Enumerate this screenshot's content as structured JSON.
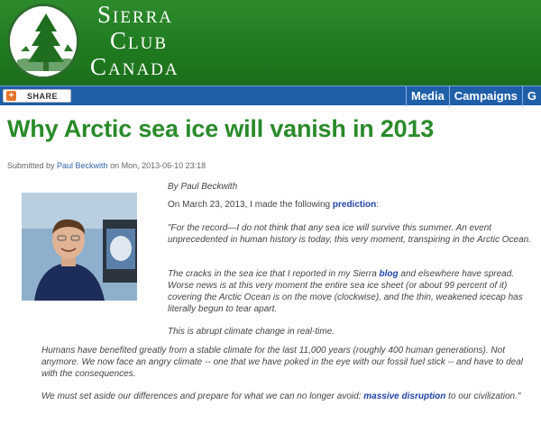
{
  "header": {
    "brand_line1": "Sierra",
    "brand_line2": "Club",
    "brand_line3": "Canada"
  },
  "navbar": {
    "share_label": "SHARE",
    "items": [
      "Media",
      "Campaigns",
      "G"
    ]
  },
  "article": {
    "title": "Why Arctic sea ice will vanish in 2013",
    "submitted_prefix": "Submitted by ",
    "submitted_author": "Paul Beckwith",
    "submitted_suffix": " on Mon, 2013-06-10 23:18",
    "byline": "By Paul Beckwith",
    "intro_text": "On March 23, 2013, I made the following ",
    "intro_link": "prediction",
    "intro_end": ":",
    "quote": "\"For the record—I do not think that any sea ice will survive this summer. An event unprecedented in human history is today, this very moment, transpiring in the Arctic Ocean.",
    "cracks_text1": "The cracks in the sea ice that I reported in my Sierra ",
    "cracks_link": "blog",
    "cracks_text2": " and elsewhere have spread. Worse news is at this very moment the entire sea ice sheet (or about 99 percent of it) covering the Arctic Ocean is on the move (clockwise), and the thin, weakened icecap has literally begun to tear apart.",
    "abrupt": "This is abrupt climate change in real-time.",
    "humans": "Humans have benefited greatly from a stable climate for the last 11,000 years (roughly 400 human generations). Not anymore. We now face an angry climate -- one that we have poked in the eye with our fossil fuel stick -- and have to deal with the consequences.",
    "aside_text1": "We must set aside our differences and prepare for what we can no longer avoid: ",
    "aside_link": "massive disruption",
    "aside_text2": " to our civilization.\""
  }
}
